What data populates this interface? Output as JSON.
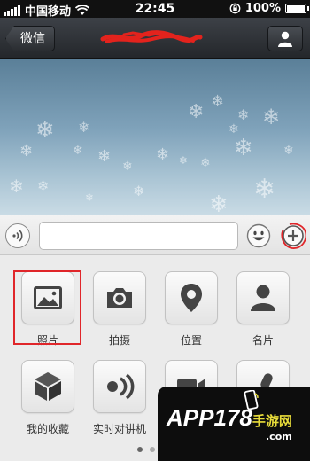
{
  "status_bar": {
    "carrier": "中国移动",
    "time": "22:45",
    "battery": "100%"
  },
  "nav": {
    "back_label": "微信",
    "profile_icon": "person-icon"
  },
  "input_bar": {
    "text_value": "",
    "voice_icon": "voice-wave-icon",
    "emoji_icon": "smiley-icon",
    "plus_icon": "plus-circle-icon"
  },
  "tools": [
    {
      "label": "照片",
      "icon": "photo-icon"
    },
    {
      "label": "拍摄",
      "icon": "camera-icon"
    },
    {
      "label": "位置",
      "icon": "location-pin-icon"
    },
    {
      "label": "名片",
      "icon": "contact-card-icon"
    },
    {
      "label": "我的收藏",
      "icon": "cube-icon"
    },
    {
      "label": "实时对讲机",
      "icon": "walkie-talkie-icon"
    },
    {
      "label": "",
      "icon": "video-camera-icon"
    },
    {
      "label": "",
      "icon": "microphone-icon"
    }
  ],
  "colors": {
    "highlight": "#e0262a",
    "nav_bar": "#2f3338",
    "panel": "#ebebeb"
  },
  "watermark": {
    "text": "APP178",
    "accent": "手游网",
    "sub": ".com"
  }
}
